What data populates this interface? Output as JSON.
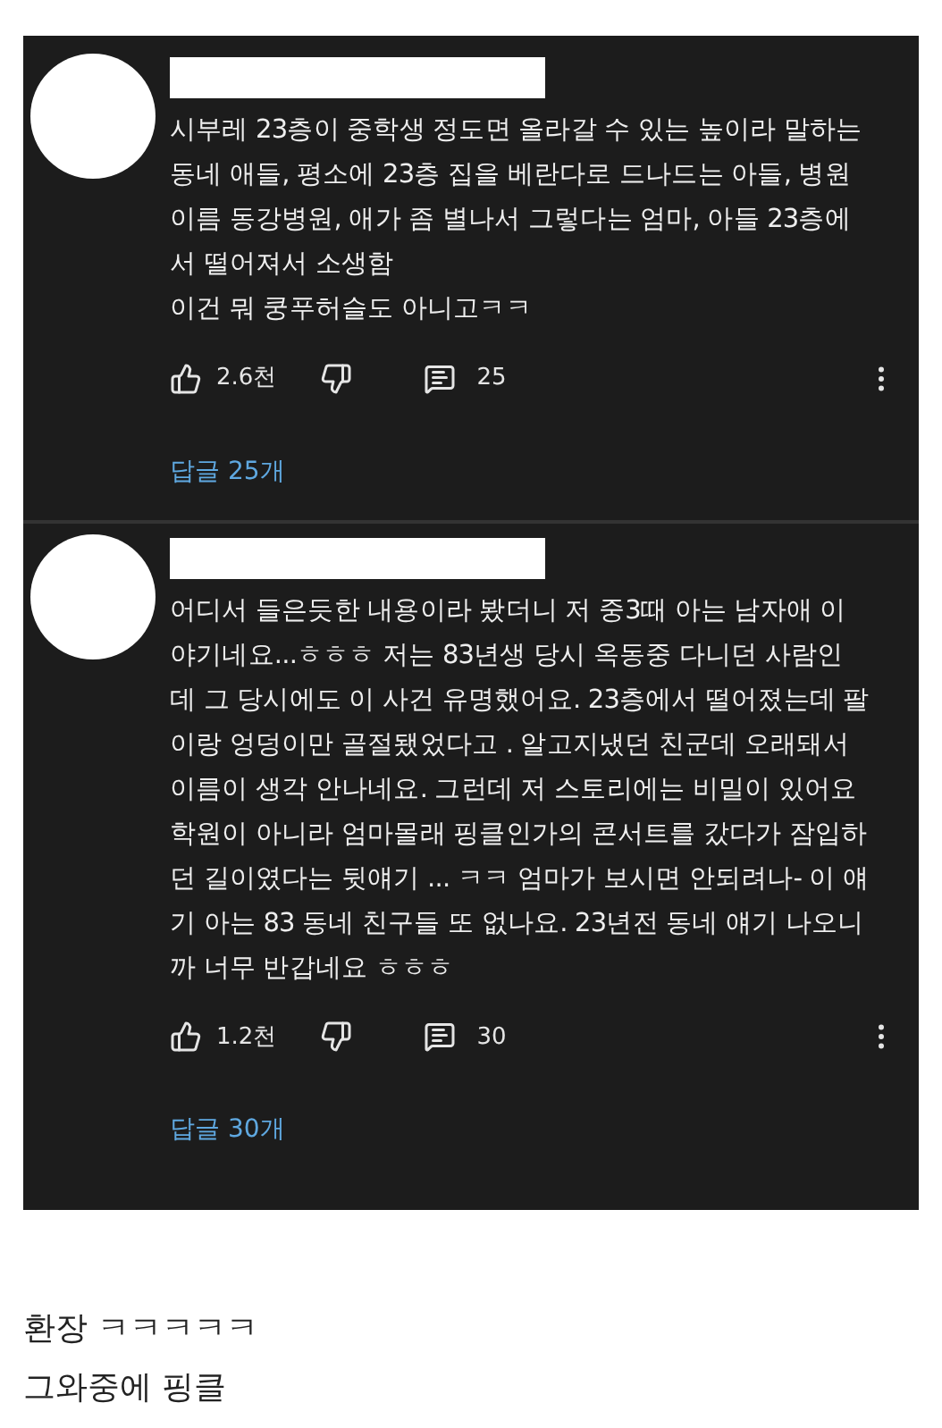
{
  "comments": [
    {
      "text": "시부레 23층이 중학생 정도면 올라갈 수 있는 높이라 말하는\n동네 애들, 평소에 23층 집을 베란다로 드나드는 아들, 병원\n이름 동강병원, 애가 좀 별나서 그렇다는 엄마, 아들 23층에\n서 떨어져서 소생함\n이건 뭐 쿵푸허슬도 아니고ㅋㅋ",
      "likes": "2.6천",
      "reply_count": "25",
      "replies_link": "답글 25개"
    },
    {
      "text": "어디서 들은듯한 내용이라 봤더니 저 중3때 아는 남자애 이\n야기네요...ㅎㅎㅎ 저는 83년생 당시 옥동중 다니던 사람인\n데 그 당시에도 이 사건 유명했어요. 23층에서 떨어졌는데 팔\n이랑 엉덩이만 골절됐었다고 . 알고지냈던 친군데 오래돼서\n이름이 생각 안나네요. 그런데 저 스토리에는 비밀이 있어요\n학원이 아니라 엄마몰래 핑클인가의 콘서트를 갔다가 잠입하\n던 길이였다는 뒷얘기 ... ㅋㅋ 엄마가 보시면 안되려나- 이 얘\n기 아는 83 동네 친구들 또 없나요. 23년전 동네 얘기 나오니\n까 너무 반갑네요 ㅎㅎㅎ",
      "likes": "1.2천",
      "reply_count": "30",
      "replies_link": "답글 30개"
    }
  ],
  "caption": [
    "환장 ㅋㅋㅋㅋㅋ",
    "그와중에 핑클"
  ]
}
